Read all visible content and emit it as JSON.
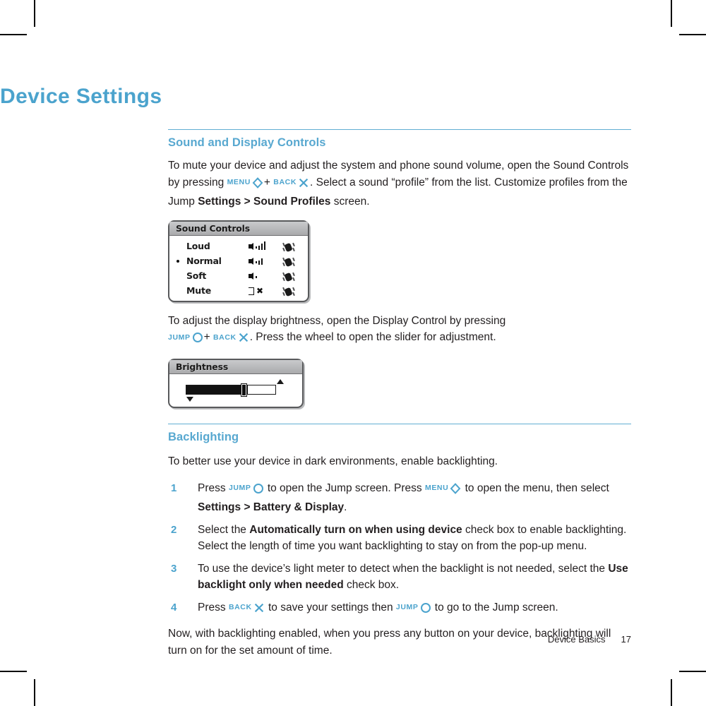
{
  "document": {
    "chapter_title": "Device Settings",
    "footer": {
      "running_head": "Device Basics",
      "page_number": "17"
    }
  },
  "colors": {
    "accent_blue": "#4ba3cd",
    "heading_blue": "#58a8d0",
    "rule_blue": "#61aed3",
    "body_text": "#231f20"
  },
  "sections": [
    {
      "id": "sound-and-display-controls",
      "title": "Sound and Display Controls",
      "paragraph_1": {
        "part_1": "To mute your device and adjust the system and phone sound volume, open the Sound Controls by pressing ",
        "key_1_label": "MENU",
        "key_1_icon": "diamond-outline-icon",
        "plus": "+",
        "key_2_label": "BACK",
        "key_2_icon": "x-mark-icon",
        "part_2": ". Select a sound “profile” from the list. Customize profiles from the Jump ",
        "bold_path": "Settings > Sound Profiles",
        "part_3": " screen."
      },
      "paragraph_2": {
        "part_1": "To adjust the display brightness, open the Display Control by pressing ",
        "key_1_label": "JUMP",
        "key_1_icon": "circle-outline-icon",
        "plus": "+",
        "key_2_label": "BACK",
        "key_2_icon": "x-mark-icon",
        "part_2": ". Press the wheel to open the slider for adjustment."
      }
    },
    {
      "id": "backlighting",
      "title": "Backlighting",
      "intro": "To better use your device in dark environments, enable backlighting.",
      "closing": "Now, with backlighting enabled, when you press any button on your device, backlighting will turn on for the set amount of time.",
      "steps": [
        {
          "number": "1",
          "text_1": "Press ",
          "key_1_label": "JUMP",
          "key_1_icon": "circle-outline-icon",
          "text_2": " to open the Jump screen. Press ",
          "key_2_label": "MENU",
          "key_2_icon": "diamond-outline-icon",
          "text_3": " to open the menu, then select ",
          "bold_1": "Settings > Battery & Display",
          "text_4": "."
        },
        {
          "number": "2",
          "text_1": "Select the ",
          "bold_1": "Automatically turn on when using device",
          "text_2": " check box to enable backlighting. Select the length of time you want backlighting to stay on from the pop-up menu."
        },
        {
          "number": "3",
          "text_1": "To use the device’s light meter to detect when the backlight is not needed, select the ",
          "bold_1": "Use backlight only when needed",
          "text_2": " check box."
        },
        {
          "number": "4",
          "text_1": "Press ",
          "key_1_label": "BACK",
          "key_1_icon": "x-mark-icon",
          "text_2": " to save your settings then ",
          "key_2_label": "JUMP",
          "key_2_icon": "circle-outline-icon",
          "text_3": " to go to the Jump screen."
        }
      ]
    }
  ],
  "figures": {
    "sound_controls": {
      "titlebar": "Sound Controls",
      "rows": [
        {
          "label": "Loud",
          "selected": false,
          "volume_icon": "speaker-loud-icon",
          "bars": 4,
          "vibrate_icon": "vibrate-icon"
        },
        {
          "label": "Normal",
          "selected": true,
          "volume_icon": "speaker-normal-icon",
          "bars": 3,
          "vibrate_icon": "vibrate-icon"
        },
        {
          "label": "Soft",
          "selected": false,
          "volume_icon": "speaker-soft-icon",
          "bars": 1,
          "vibrate_icon": "vibrate-icon"
        },
        {
          "label": "Mute",
          "selected": false,
          "volume_icon": "speaker-mute-icon",
          "bars": 0,
          "vibrate_icon": "vibrate-icon"
        }
      ]
    },
    "brightness": {
      "titlebar": "Brightness",
      "slider_value_percent": "69",
      "up_arrow_icon": "triangle-up-icon",
      "down_arrow_icon": "triangle-down-icon"
    }
  }
}
